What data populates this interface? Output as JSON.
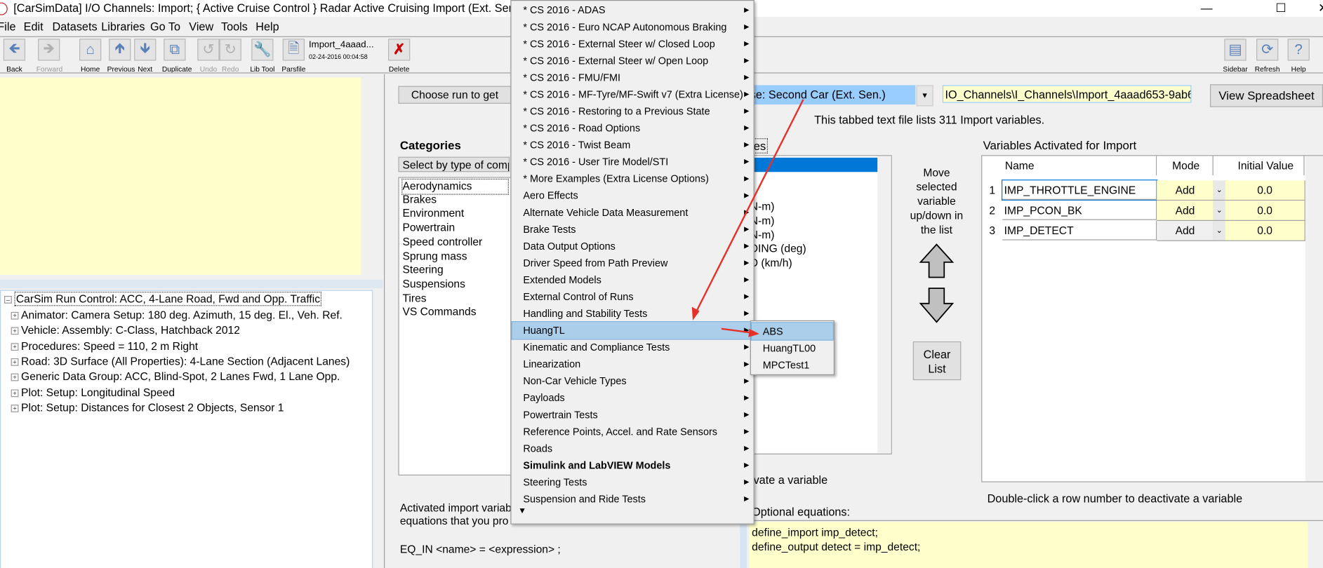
{
  "window": {
    "title": "[CarSimData] I/O Channels: Import; { Active Cruise Control } Radar Active Cruising Import (Ext. Sen.",
    "controls": [
      "minimize",
      "maximize",
      "close"
    ]
  },
  "menubar": [
    "File",
    "Edit",
    "Datasets",
    "Libraries",
    "Go To",
    "View",
    "Tools",
    "Help"
  ],
  "toolbar": {
    "buttons": [
      {
        "label": "Back",
        "icon": "arrow-left-icon",
        "enabled": true
      },
      {
        "label": "Forward",
        "icon": "arrow-right-icon",
        "enabled": false
      },
      {
        "label": "Home",
        "icon": "home-icon",
        "enabled": true
      },
      {
        "label": "Previous",
        "icon": "arrow-up-icon",
        "enabled": true
      },
      {
        "label": "Next",
        "icon": "arrow-down-icon",
        "enabled": true
      },
      {
        "label": "Duplicate",
        "icon": "duplicate-icon",
        "enabled": true
      },
      {
        "label": "Undo",
        "icon": "undo-icon",
        "enabled": false
      },
      {
        "label": "Redo",
        "icon": "redo-icon",
        "enabled": false
      },
      {
        "label": "Lib Tool",
        "icon": "wrench-icon",
        "enabled": true
      },
      {
        "label": "Parsfile",
        "icon": "document-icon",
        "enabled": true
      },
      {
        "label": "Delete",
        "icon": "delete-x-icon",
        "enabled": true
      }
    ],
    "dataset_name": "Import_4aaad...",
    "dataset_date": "02-24-2016 00:04:58",
    "right_buttons": [
      {
        "label": "Sidebar",
        "icon": "sidebar-icon"
      },
      {
        "label": "Refresh",
        "icon": "refresh-icon"
      },
      {
        "label": "Help",
        "icon": "help-icon"
      }
    ]
  },
  "tree": {
    "root": "CarSim Run Control: ACC, 4-Lane Road, Fwd and Opp. Traffic",
    "children": [
      "Animator: Camera Setup: 180 deg. Azimuth, 15 deg. El., Veh. Ref.",
      "Vehicle: Assembly: C-Class, Hatchback 2012",
      "Procedures: Speed = 110, 2 m Right",
      "Road: 3D Surface (All Properties): 4-Lane Section (Adjacent Lanes)",
      "Generic Data Group: ACC, Blind-Spot, 2 Lanes Fwd, 1 Lane Opp.",
      "Plot: Setup: Longitudinal Speed",
      "Plot: Setup: Distances for Closest 2 Objects, Sensor 1"
    ]
  },
  "main": {
    "choose_run_button": "Choose run to get",
    "run_select_value": "ise: Second Car (Ext. Sen.)",
    "path_field": "IO_Channels\\I_Channels\\Import_4aaad653-9ab6-",
    "view_spreadsheet": "View Spreadsheet",
    "info_text": "This tabbed text file lists 311 Import variables.",
    "categories_label": "Categories",
    "categories_select": "Select by type of comp",
    "categories": [
      "Aerodynamics",
      "Brakes",
      "Environment",
      "Powertrain",
      "Speed controller",
      "Sprung mass",
      "Steering",
      "Suspensions",
      "Tires",
      "VS Commands"
    ],
    "variables_label": "es",
    "variables": [
      ")",
      ")",
      ")",
      "N-m)",
      "N-m)",
      "N-m)",
      "DING (deg)",
      "D (km/h)"
    ],
    "move_text": "Move selected variable up/down in the list",
    "clear_list": "Clear List",
    "activate_hint": "vate a variable",
    "activated_text_1": "Activated import variab",
    "activated_text_2": "equations that you pro",
    "eq_in": "EQ_IN <name> = <expression> ;",
    "optional_label": "Optional equations:",
    "equations": [
      "define_import imp_detect;",
      "define_output detect = imp_detect;"
    ]
  },
  "activated": {
    "title": "Variables Activated for Import",
    "headers": [
      "Name",
      "Mode",
      "Initial Value"
    ],
    "rows": [
      {
        "num": "1",
        "name": "IMP_THROTTLE_ENGINE",
        "mode": "Add",
        "value": "0.0"
      },
      {
        "num": "2",
        "name": "IMP_PCON_BK",
        "mode": "Add",
        "value": "0.0"
      },
      {
        "num": "3",
        "name": "IMP_DETECT",
        "mode": "Add",
        "value": "0.0"
      }
    ],
    "hint": "Double-click a row number to deactivate a variable"
  },
  "dropdown_menu": {
    "items": [
      {
        "label": "* CS 2016 - ADAS"
      },
      {
        "label": "* CS 2016 - Euro NCAP Autonomous Braking"
      },
      {
        "label": "* CS 2016 - External Steer w/ Closed Loop"
      },
      {
        "label": "* CS 2016 - External Steer w/ Open Loop"
      },
      {
        "label": "* CS 2016 - FMU/FMI"
      },
      {
        "label": "* CS 2016 - MF-Tyre/MF-Swift v7 (Extra License)"
      },
      {
        "label": "* CS 2016 - Restoring to a Previous State"
      },
      {
        "label": "* CS 2016 - Road Options"
      },
      {
        "label": "* CS 2016 - Twist Beam"
      },
      {
        "label": "* CS 2016 - User Tire Model/STI"
      },
      {
        "label": "* More Examples (Extra License Options)"
      },
      {
        "label": "Aero Effects"
      },
      {
        "label": "Alternate Vehicle Data Measurement"
      },
      {
        "label": "Brake Tests"
      },
      {
        "label": "Data Output Options"
      },
      {
        "label": "Driver Speed from Path Preview"
      },
      {
        "label": "Extended Models"
      },
      {
        "label": "External Control of Runs"
      },
      {
        "label": "Handling and Stability Tests"
      },
      {
        "label": "HuangTL",
        "highlighted": true
      },
      {
        "label": "Kinematic and Compliance Tests"
      },
      {
        "label": "Linearization"
      },
      {
        "label": "Non-Car Vehicle Types"
      },
      {
        "label": "Payloads"
      },
      {
        "label": "Powertrain Tests"
      },
      {
        "label": "Reference Points, Accel. and Rate Sensors"
      },
      {
        "label": "Roads"
      },
      {
        "label": "Simulink and LabVIEW Models",
        "bold": true
      },
      {
        "label": "Steering Tests"
      },
      {
        "label": "Suspension and Ride Tests"
      }
    ],
    "submenu": [
      {
        "label": "ABS",
        "highlighted": true
      },
      {
        "label": "HuangTL00"
      },
      {
        "label": "MPCTest1"
      }
    ]
  },
  "colors": {
    "selection_blue": "#0078d7",
    "menu_highlight": "#abcfea",
    "field_yellow": "#ffffcc",
    "annotation_red": "#e8302a"
  }
}
